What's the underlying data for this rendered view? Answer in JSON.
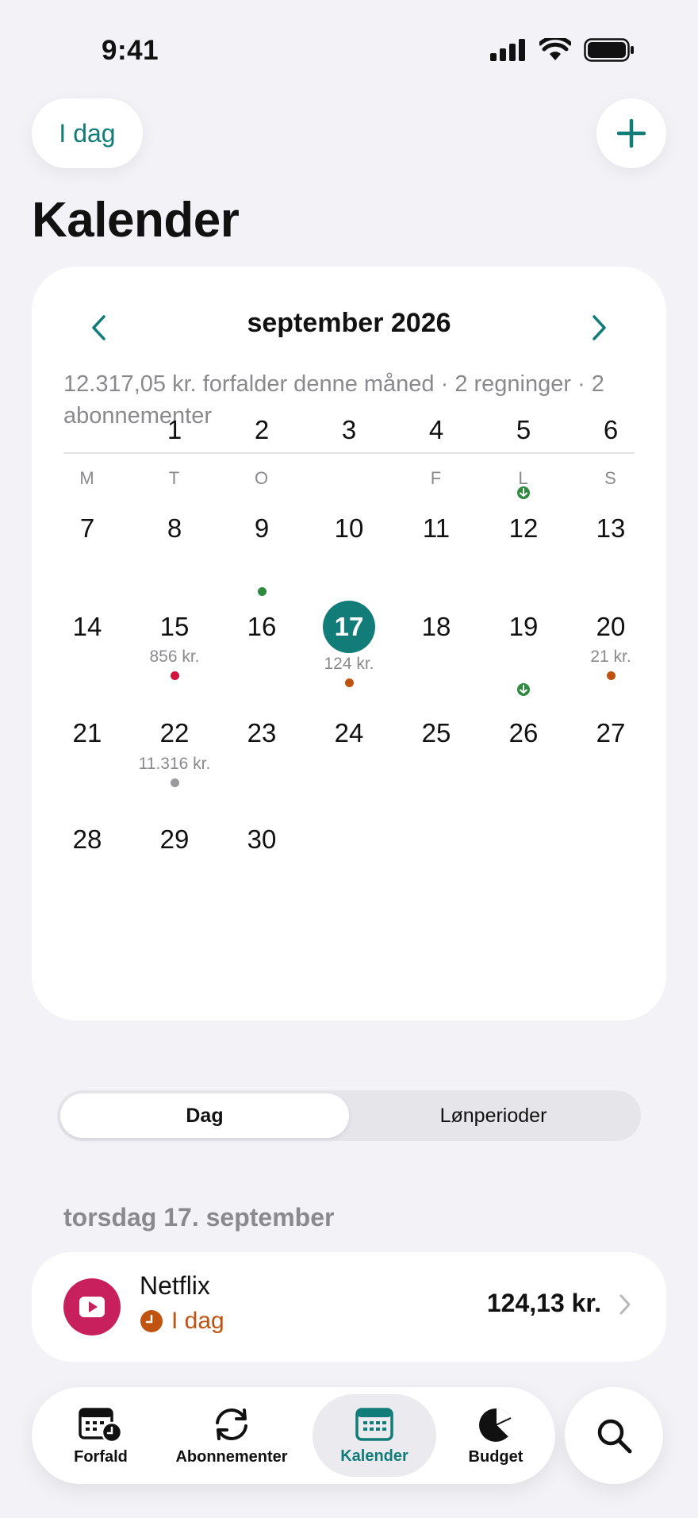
{
  "status": {
    "time": "9:41"
  },
  "header": {
    "today_label": "I dag",
    "title": "Kalender"
  },
  "calendar": {
    "month_label": "september 2026",
    "summary": "12.317,05 kr. forfalder denne måned · 2 regninger · 2 abonnementer",
    "weekdays": [
      "M",
      "T",
      "O",
      "",
      "F",
      "L",
      "S"
    ],
    "today": 17,
    "accent": "#127c78",
    "days": [
      {
        "n": 1,
        "col": 1,
        "row": 0
      },
      {
        "n": 2,
        "col": 2,
        "row": 0
      },
      {
        "n": 3,
        "col": 3,
        "row": 0
      },
      {
        "n": 4,
        "col": 4,
        "row": 0
      },
      {
        "n": 5,
        "col": 5,
        "row": 0,
        "marker": "income"
      },
      {
        "n": 6,
        "col": 6,
        "row": 0
      },
      {
        "n": 7,
        "col": 0,
        "row": 1
      },
      {
        "n": 8,
        "col": 1,
        "row": 1
      },
      {
        "n": 9,
        "col": 2,
        "row": 1,
        "marker": "dot",
        "dot_color": "#2e8b3e"
      },
      {
        "n": 10,
        "col": 3,
        "row": 1
      },
      {
        "n": 11,
        "col": 4,
        "row": 1
      },
      {
        "n": 12,
        "col": 5,
        "row": 1
      },
      {
        "n": 13,
        "col": 6,
        "row": 1
      },
      {
        "n": 14,
        "col": 0,
        "row": 2
      },
      {
        "n": 15,
        "col": 1,
        "row": 2,
        "amount": "856 kr.",
        "marker": "dot",
        "dot_color": "#d0143c"
      },
      {
        "n": 16,
        "col": 2,
        "row": 2
      },
      {
        "n": 17,
        "col": 3,
        "row": 2,
        "amount": "124 kr.",
        "marker": "dot",
        "dot_color": "#c0530f"
      },
      {
        "n": 18,
        "col": 4,
        "row": 2
      },
      {
        "n": 19,
        "col": 5,
        "row": 2,
        "marker": "income"
      },
      {
        "n": 20,
        "col": 6,
        "row": 2,
        "amount": "21 kr.",
        "marker": "dot",
        "dot_color": "#c0530f"
      },
      {
        "n": 21,
        "col": 0,
        "row": 3
      },
      {
        "n": 22,
        "col": 1,
        "row": 3,
        "amount": "11.316 kr.",
        "marker": "dot",
        "dot_color": "#9a9a9e"
      },
      {
        "n": 23,
        "col": 2,
        "row": 3
      },
      {
        "n": 24,
        "col": 3,
        "row": 3
      },
      {
        "n": 25,
        "col": 4,
        "row": 3
      },
      {
        "n": 26,
        "col": 5,
        "row": 3
      },
      {
        "n": 27,
        "col": 6,
        "row": 3
      },
      {
        "n": 28,
        "col": 0,
        "row": 4
      },
      {
        "n": 29,
        "col": 1,
        "row": 4
      },
      {
        "n": 30,
        "col": 2,
        "row": 4
      }
    ]
  },
  "segmented": {
    "day_label": "Dag",
    "pay_label": "Lønperioder"
  },
  "list": {
    "date_heading": "torsdag 17. september",
    "bill": {
      "name": "Netflix",
      "status": "I dag",
      "amount": "124,13 kr.",
      "icon": "play-icon",
      "icon_color": "#c8205c"
    }
  },
  "tabs": [
    {
      "label": "Forfald",
      "icon": "calendar-clock-icon"
    },
    {
      "label": "Abonnementer",
      "icon": "refresh-icon"
    },
    {
      "label": "Kalender",
      "icon": "calendar-icon",
      "active": true
    },
    {
      "label": "Budget",
      "icon": "pie-chart-icon"
    }
  ],
  "colors": {
    "accent": "#127c78",
    "income": "#2e8b3e",
    "warning": "#c0530f",
    "brand_netflix": "#c8205c"
  }
}
